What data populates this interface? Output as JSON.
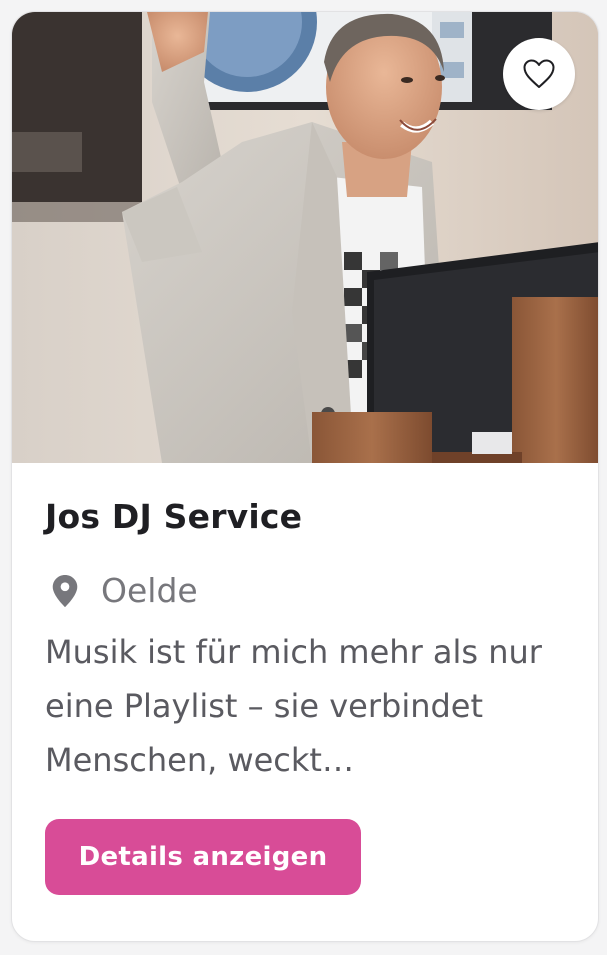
{
  "listing": {
    "title": "Jos DJ Service",
    "location": "Oelde",
    "description": "Musik ist für mich mehr als nur eine Playlist – sie verbindet Menschen, weckt…",
    "details_label": "Details anzeigen",
    "favorite_icon": "heart-outline-icon",
    "location_icon": "map-pin-icon",
    "photo_subject": "DJ performing behind a laptop",
    "colors": {
      "accent": "#d84c97",
      "title": "#1f1f23",
      "muted": "#77777c",
      "text": "#5a5a60"
    }
  }
}
